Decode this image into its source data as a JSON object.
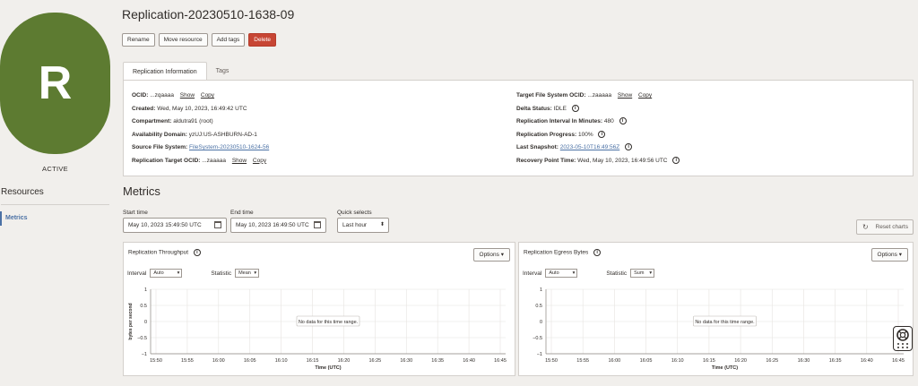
{
  "badge": {
    "letter": "R",
    "status": "ACTIVE"
  },
  "resources": {
    "title": "Resources",
    "items": [
      {
        "label": "Metrics"
      }
    ]
  },
  "header": {
    "title": "Replication-20230510-1638-09",
    "actions": {
      "rename": "Rename",
      "move": "Move resource",
      "add_tags": "Add tags",
      "delete": "Delete"
    }
  },
  "tabs": [
    {
      "label": "Replication Information"
    },
    {
      "label": "Tags"
    }
  ],
  "info": {
    "show": "Show",
    "copy": "Copy",
    "ocid": {
      "label": "OCID:",
      "value": "...zqaaaa"
    },
    "created": {
      "label": "Created:",
      "value": "Wed, May 10, 2023, 16:49:42 UTC"
    },
    "compartment": {
      "label": "Compartment:",
      "value": "aldutra91 (root)"
    },
    "ad": {
      "label": "Availability Domain:",
      "value": "yzUJ:US-ASHBURN-AD-1"
    },
    "source_fs": {
      "label": "Source File System:",
      "value": "FileSystem-20230510-1624-56"
    },
    "target_ocid": {
      "label": "Replication Target OCID:",
      "value": "...zaaaaa"
    },
    "target_fs_ocid": {
      "label": "Target File System OCID:",
      "value": "...zaaaaa"
    },
    "delta_status": {
      "label": "Delta Status:",
      "value": "IDLE"
    },
    "interval": {
      "label": "Replication Interval In Minutes:",
      "value": "480"
    },
    "progress": {
      "label": "Replication Progress:",
      "value": "100%"
    },
    "last_snapshot": {
      "label": "Last Snapshot:",
      "value": "2023-05-10T16:49:56Z"
    },
    "recovery_point": {
      "label": "Recovery Point Time:",
      "value": "Wed, May 10, 2023, 16:49:56 UTC"
    }
  },
  "metrics": {
    "title": "Metrics",
    "start_label": "Start time",
    "start_value": "May 10, 2023 15:49:50 UTC",
    "end_label": "End time",
    "end_value": "May 10, 2023 16:49:50 UTC",
    "quick_label": "Quick selects",
    "quick_value": "Last hour",
    "reset": "Reset charts",
    "options": "Options",
    "interval_label": "Interval",
    "interval_value": "Auto",
    "statistic_label": "Statistic",
    "no_data": "No data for this time range."
  },
  "chart_data": [
    {
      "type": "line",
      "title": "Replication Throughput",
      "statistic": "Mean",
      "xlabel": "Time (UTC)",
      "ylabel": "bytes per second",
      "x_ticks": [
        "15:50",
        "15:55",
        "16:00",
        "16:05",
        "16:10",
        "16:15",
        "16:20",
        "16:25",
        "16:30",
        "16:35",
        "16:40",
        "16:45"
      ],
      "y_ticks": [
        "1",
        "0.5",
        "0",
        "−0.5",
        "−1"
      ],
      "ylim": [
        -1,
        1
      ],
      "series": [],
      "grid": true
    },
    {
      "type": "line",
      "title": "Replication Egress Bytes",
      "statistic": "Sum",
      "xlabel": "Time (UTC)",
      "ylabel": "",
      "x_ticks": [
        "15:50",
        "15:55",
        "16:00",
        "16:05",
        "16:10",
        "16:15",
        "16:20",
        "16:25",
        "16:30",
        "16:35",
        "16:40",
        "16:45"
      ],
      "y_ticks": [
        "1",
        "0.5",
        "0",
        "−0.5",
        "−1"
      ],
      "ylim": [
        -1,
        1
      ],
      "series": [],
      "grid": true
    }
  ],
  "colors": {
    "brand_badge": "#5d7b31",
    "danger": "#c74634",
    "accent": "#4b71a5"
  }
}
